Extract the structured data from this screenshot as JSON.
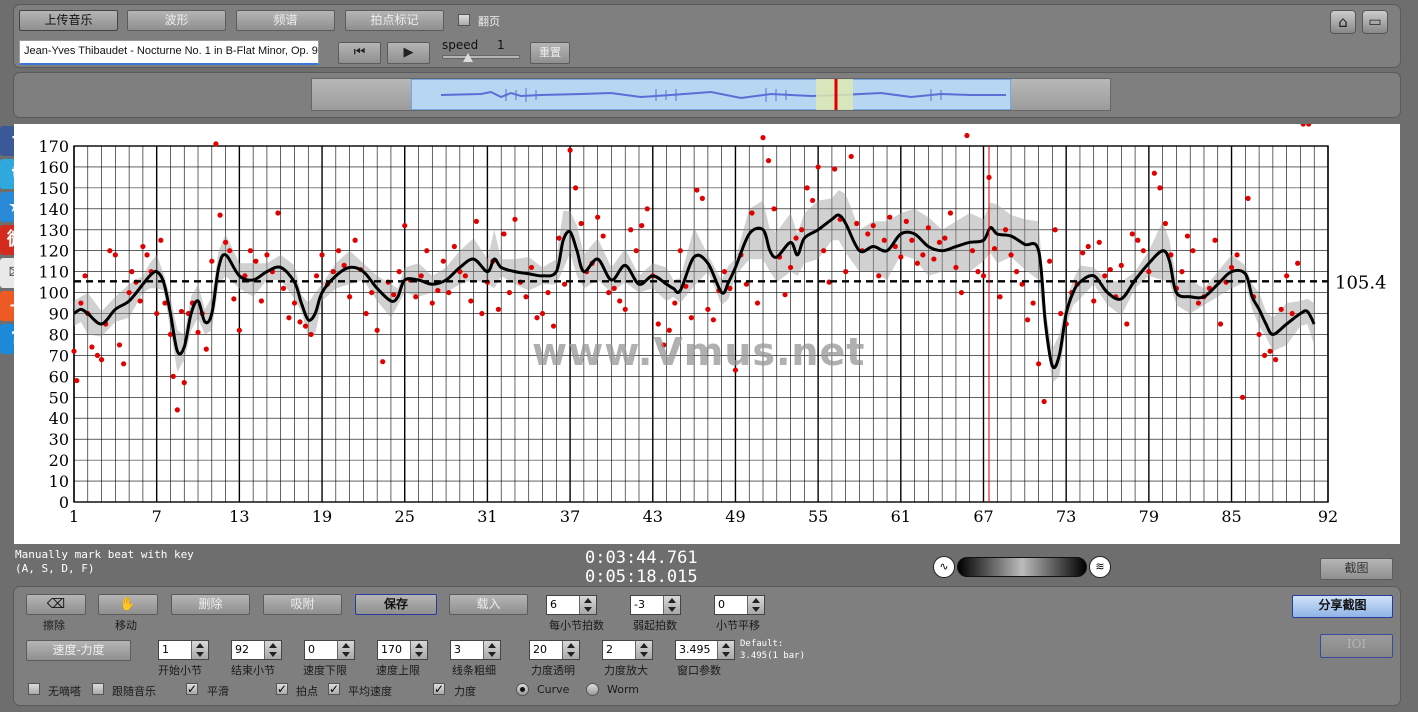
{
  "toolbar": {
    "upload": "上传音乐",
    "waveform": "波形",
    "spectrum": "频谱",
    "beat_mark": "拍点标记",
    "flip_page": "翻页"
  },
  "track": {
    "title": "Jean-Yves Thibaudet - Nocturne No. 1 in B-Flat Minor, Op. 9"
  },
  "transport": {
    "speed_label": "speed",
    "speed_value": "1",
    "reset": "重置"
  },
  "colors": {
    "accent_red": "#e00000",
    "waveform_blue": "#5a6fd6",
    "panel_gray": "#7f7f7f"
  },
  "status": {
    "hint_line1": "Manually mark beat with key",
    "hint_line2": "(A, S, D, F)",
    "current_time": "0:03:44.761",
    "total_time": "0:05:18.015",
    "screenshot": "截图"
  },
  "controls": {
    "erase": "擦除",
    "move": "移动",
    "delete": "删除",
    "snap": "吸附",
    "save": "保存",
    "load": "载入",
    "beats_per_bar_value": "6",
    "beats_per_bar_label": "每小节拍数",
    "pickup_value": "-3",
    "pickup_label": "弱起拍数",
    "bar_offset_value": "0",
    "bar_offset_label": "小节平移",
    "share_screenshot": "分享截图",
    "ioi": "IOI",
    "tempo_dynamics": "速度-力度",
    "start_bar_value": "1",
    "start_bar_label": "开始小节",
    "end_bar_value": "92",
    "end_bar_label": "结束小节",
    "tempo_min_value": "0",
    "tempo_min_label": "速度下限",
    "tempo_max_value": "170",
    "tempo_max_label": "速度上限",
    "line_width_value": "3",
    "line_width_label": "线条粗细",
    "dyn_opacity_value": "20",
    "dyn_opacity_label": "力度透明",
    "dyn_scale_value": "2",
    "dyn_scale_label": "力度放大",
    "window_value": "3.495",
    "window_label": "窗口参数",
    "default_line1": "Default:",
    "default_line2": "3.495(1 bar)",
    "no_click": "无嘀嗒",
    "follow_music": "跟随音乐",
    "smooth": "平滑",
    "beats": "拍点",
    "avg_tempo": "平均速度",
    "dynamics": "力度",
    "curve": "Curve",
    "worm": "Worm"
  },
  "watermark": "www.Vmus.net",
  "social": [
    {
      "icon": "facebook-icon",
      "color": "#3b5998",
      "glyph": "f"
    },
    {
      "icon": "twitter-icon",
      "color": "#2fa8dd",
      "glyph": "t"
    },
    {
      "icon": "favorite-star-icon",
      "color": "#2a8ad8",
      "glyph": "★"
    },
    {
      "icon": "weibo-icon",
      "color": "#d52b1e",
      "glyph": "微"
    },
    {
      "icon": "mail-icon",
      "color": "#e8e8e8",
      "glyph": "✉"
    },
    {
      "icon": "add-share-icon",
      "color": "#ee5a24",
      "glyph": "+"
    },
    {
      "icon": "help-icon",
      "color": "#1d8ad9",
      "glyph": "?"
    }
  ],
  "chart_data": {
    "type": "line",
    "ylim": [
      0,
      170
    ],
    "xlim": [
      1,
      92
    ],
    "y_ticks": [
      0,
      10,
      20,
      30,
      40,
      50,
      60,
      70,
      80,
      90,
      100,
      110,
      120,
      130,
      140,
      150,
      160,
      170
    ],
    "x_ticks": [
      1,
      7,
      13,
      19,
      25,
      31,
      37,
      43,
      49,
      55,
      61,
      67,
      73,
      79,
      85,
      92
    ],
    "average_tempo": 105.4,
    "average_label": "105.4",
    "playhead_bar": 67.4,
    "tempo_curve": {
      "x": [
        1,
        1.5,
        2,
        3,
        4,
        5,
        6,
        6.5,
        7,
        7.5,
        8,
        8.5,
        9,
        9.5,
        10,
        10.5,
        11,
        11.5,
        12,
        13,
        14,
        15,
        16,
        17,
        17.5,
        18,
        18.5,
        19,
        20,
        21,
        22,
        23,
        24,
        24.5,
        25,
        26,
        27,
        28,
        29,
        30,
        31,
        31.5,
        32,
        33,
        34,
        35,
        36,
        36.5,
        37,
        37.5,
        38,
        39,
        40,
        41,
        42,
        43,
        44,
        44.5,
        45,
        46,
        47,
        48,
        48.5,
        49,
        50,
        51,
        51.5,
        52,
        53,
        53.5,
        54,
        55,
        56,
        56.5,
        57,
        58,
        59,
        60,
        61,
        62,
        63,
        64,
        65,
        66,
        67,
        67.5,
        68,
        69,
        70,
        71,
        71.5,
        72,
        72.5,
        73,
        73.5,
        74,
        75,
        76,
        77,
        78,
        79,
        80,
        80.5,
        81,
        82,
        83,
        84,
        85,
        86,
        86.5,
        87,
        87.5,
        88,
        89,
        90,
        90.5,
        91
      ],
      "y": [
        90,
        92,
        90,
        85,
        92,
        96,
        104,
        108,
        110,
        105,
        90,
        72,
        74,
        90,
        96,
        86,
        90,
        112,
        118,
        108,
        106,
        110,
        112,
        105,
        95,
        87,
        90,
        100,
        108,
        112,
        110,
        102,
        96,
        98,
        106,
        106,
        104,
        106,
        112,
        116,
        110,
        116,
        112,
        110,
        109,
        108,
        110,
        125,
        129,
        120,
        110,
        116,
        106,
        113,
        104,
        108,
        104,
        102,
        101,
        117,
        114,
        100,
        105,
        112,
        128,
        130,
        120,
        117,
        124,
        118,
        126,
        130,
        135,
        137,
        133,
        120,
        122,
        120,
        128,
        128,
        122,
        120,
        122,
        124,
        125,
        131,
        128,
        127,
        123,
        120,
        85,
        65,
        70,
        90,
        100,
        105,
        108,
        100,
        97,
        106,
        114,
        120,
        115,
        100,
        98,
        98,
        104,
        110,
        109,
        98,
        92,
        85,
        80,
        85,
        90,
        91,
        85,
        28
      ]
    },
    "dynamics_band_note": "shaded gray band around tempo curve",
    "scatter": {
      "x": [
        1,
        1.2,
        1.5,
        1.8,
        2,
        2.3,
        2.7,
        3,
        3.3,
        3.6,
        4,
        4.3,
        4.6,
        5,
        5.2,
        5.5,
        5.8,
        6,
        6.3,
        6.6,
        7,
        7.3,
        7.6,
        8,
        8.2,
        8.5,
        8.8,
        9,
        9.3,
        9.6,
        10,
        10.3,
        10.6,
        11,
        11.3,
        11.6,
        12,
        12.3,
        12.6,
        13,
        13.4,
        13.8,
        14.2,
        14.6,
        15,
        15.4,
        15.8,
        16.2,
        16.6,
        17,
        17.4,
        17.8,
        18.2,
        18.6,
        19,
        19.4,
        19.8,
        20.2,
        20.6,
        21,
        21.4,
        21.8,
        22.2,
        22.6,
        23,
        23.4,
        23.8,
        24.2,
        24.6,
        25,
        25.4,
        25.8,
        26.2,
        26.6,
        27,
        27.4,
        27.8,
        28.2,
        28.6,
        29,
        29.4,
        29.8,
        30.2,
        30.6,
        31,
        31.4,
        31.8,
        32.2,
        32.6,
        33,
        33.4,
        33.8,
        34.2,
        34.6,
        35,
        35.4,
        35.8,
        36.2,
        36.6,
        37,
        37.4,
        37.8,
        38.2,
        38.6,
        39,
        39.4,
        39.8,
        40.2,
        40.6,
        41,
        41.4,
        41.8,
        42.2,
        42.6,
        43,
        43.4,
        43.8,
        44.2,
        44.6,
        45,
        45.4,
        45.8,
        46.2,
        46.6,
        47,
        47.4,
        47.8,
        48.2,
        48.6,
        49,
        49.4,
        49.8,
        50.2,
        50.6,
        51,
        51.4,
        51.8,
        52.2,
        52.6,
        53,
        53.4,
        53.8,
        54.2,
        54.6,
        55,
        55.4,
        55.8,
        56.2,
        56.6,
        57,
        57.4,
        57.8,
        58.2,
        58.6,
        59,
        59.4,
        59.8,
        60.2,
        60.6,
        61,
        61.4,
        61.8,
        62.2,
        62.6,
        63,
        63.4,
        63.8,
        64.2,
        64.6,
        65,
        65.4,
        65.8,
        66.2,
        66.6,
        67,
        67.4,
        67.8,
        68.2,
        68.6,
        69,
        69.4,
        69.8,
        70.2,
        70.6,
        71,
        71.4,
        71.8,
        72.2,
        72.6,
        73,
        73.4,
        73.8,
        74.2,
        74.6,
        75,
        75.4,
        75.8,
        76.2,
        76.6,
        77,
        77.4,
        77.8,
        78.2,
        78.6,
        79,
        79.4,
        79.8,
        80.2,
        80.6,
        81,
        81.4,
        81.8,
        82.2,
        82.6,
        83,
        83.4,
        83.8,
        84.2,
        84.6,
        85,
        85.4,
        85.8,
        86.2,
        86.6,
        87,
        87.4,
        87.8,
        88.2,
        88.6,
        89,
        89.4,
        89.8,
        90.2,
        90.6
      ],
      "y": [
        72,
        58,
        95,
        108,
        90,
        74,
        70,
        68,
        85,
        120,
        118,
        75,
        66,
        100,
        110,
        105,
        96,
        122,
        118,
        110,
        90,
        125,
        95,
        80,
        60,
        44,
        91,
        57,
        90,
        95,
        81,
        90,
        73,
        115,
        171,
        137,
        124,
        120,
        97,
        82,
        108,
        120,
        115,
        96,
        118,
        110,
        138,
        102,
        88,
        95,
        86,
        84,
        80,
        108,
        118,
        104,
        110,
        120,
        113,
        98,
        125,
        111,
        90,
        100,
        82,
        67,
        105,
        99,
        110,
        132,
        106,
        98,
        108,
        120,
        95,
        101,
        115,
        100,
        122,
        110,
        108,
        96,
        134,
        90,
        105,
        115,
        92,
        128,
        100,
        135,
        105,
        98,
        112,
        88,
        90,
        100,
        84,
        126,
        104,
        168,
        150,
        133,
        110,
        114,
        136,
        127,
        100,
        102,
        96,
        92,
        130,
        120,
        132,
        140,
        108,
        85,
        75,
        82,
        95,
        120,
        103,
        88,
        149,
        145,
        92,
        87,
        101,
        110,
        102,
        63,
        118,
        104,
        138,
        95,
        174,
        163,
        140,
        117,
        99,
        112,
        126,
        130,
        150,
        144,
        160,
        120,
        105,
        159,
        135,
        110,
        165,
        133,
        120,
        128,
        132,
        108,
        125,
        136,
        122,
        117,
        134,
        125,
        114,
        118,
        131,
        116,
        124,
        126,
        138,
        112,
        100,
        175,
        120,
        110,
        108,
        155,
        121,
        98,
        130,
        118,
        110,
        104,
        87,
        95,
        66,
        48,
        115,
        130,
        90,
        85,
        100,
        104,
        119,
        122,
        96,
        124,
        108,
        111,
        98,
        113,
        85,
        128,
        125,
        120,
        110,
        157,
        150,
        133,
        118,
        102,
        110,
        127,
        120,
        95,
        98,
        102,
        125,
        85,
        105,
        112,
        118,
        50,
        145,
        98,
        80,
        70,
        72,
        68,
        92,
        108,
        90,
        114
      ]
    }
  }
}
